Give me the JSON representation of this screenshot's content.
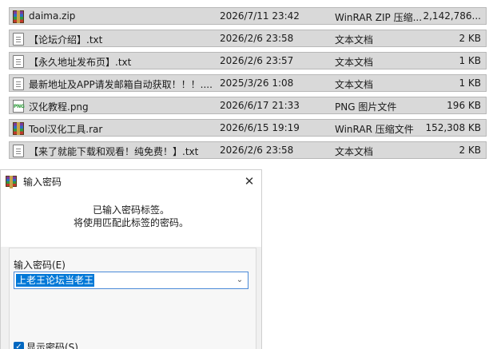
{
  "files": [
    {
      "name": "daima.zip",
      "date": "2026/7/11 23:42",
      "type": "WinRAR ZIP 压缩...",
      "size": "2,142,786...",
      "icon": "winrar-archive-icon"
    },
    {
      "name": "【论坛介绍】.txt",
      "date": "2026/2/6 23:58",
      "type": "文本文档",
      "size": "2 KB",
      "icon": "text-document-icon"
    },
    {
      "name": "【永久地址发布页】.txt",
      "date": "2026/2/6 23:57",
      "type": "文本文档",
      "size": "1 KB",
      "icon": "text-document-icon"
    },
    {
      "name": "最新地址及APP请发邮箱自动获取！！！....",
      "date": "2025/3/26 1:08",
      "type": "文本文档",
      "size": "1 KB",
      "icon": "text-document-icon"
    },
    {
      "name": "汉化教程.png",
      "date": "2026/6/17 21:33",
      "type": "PNG 图片文件",
      "size": "196 KB",
      "icon": "png-image-icon"
    },
    {
      "name": "Tool汉化工具.rar",
      "date": "2026/6/15 19:19",
      "type": "WinRAR 压缩文件",
      "size": "152,308 KB",
      "icon": "winrar-archive-icon"
    },
    {
      "name": "【来了就能下载和观看！纯免费！】.txt",
      "date": "2026/2/6 23:58",
      "type": "文本文档",
      "size": "2 KB",
      "icon": "text-document-icon"
    }
  ],
  "dialog": {
    "title": "输入密码",
    "close_glyph": "✕",
    "message_line1": "已输入密码标签。",
    "message_line2": "将使用匹配此标签的密码。",
    "password_label": "输入密码(E)",
    "password_value": "上老王论坛当老王",
    "dropdown_glyph": "⌄",
    "show_password_label": "显示密码(S)",
    "show_password_checked": true
  },
  "colors": {
    "row_background": "#d9d9d9",
    "selection": "#0078d7",
    "checkbox": "#0067c0"
  }
}
